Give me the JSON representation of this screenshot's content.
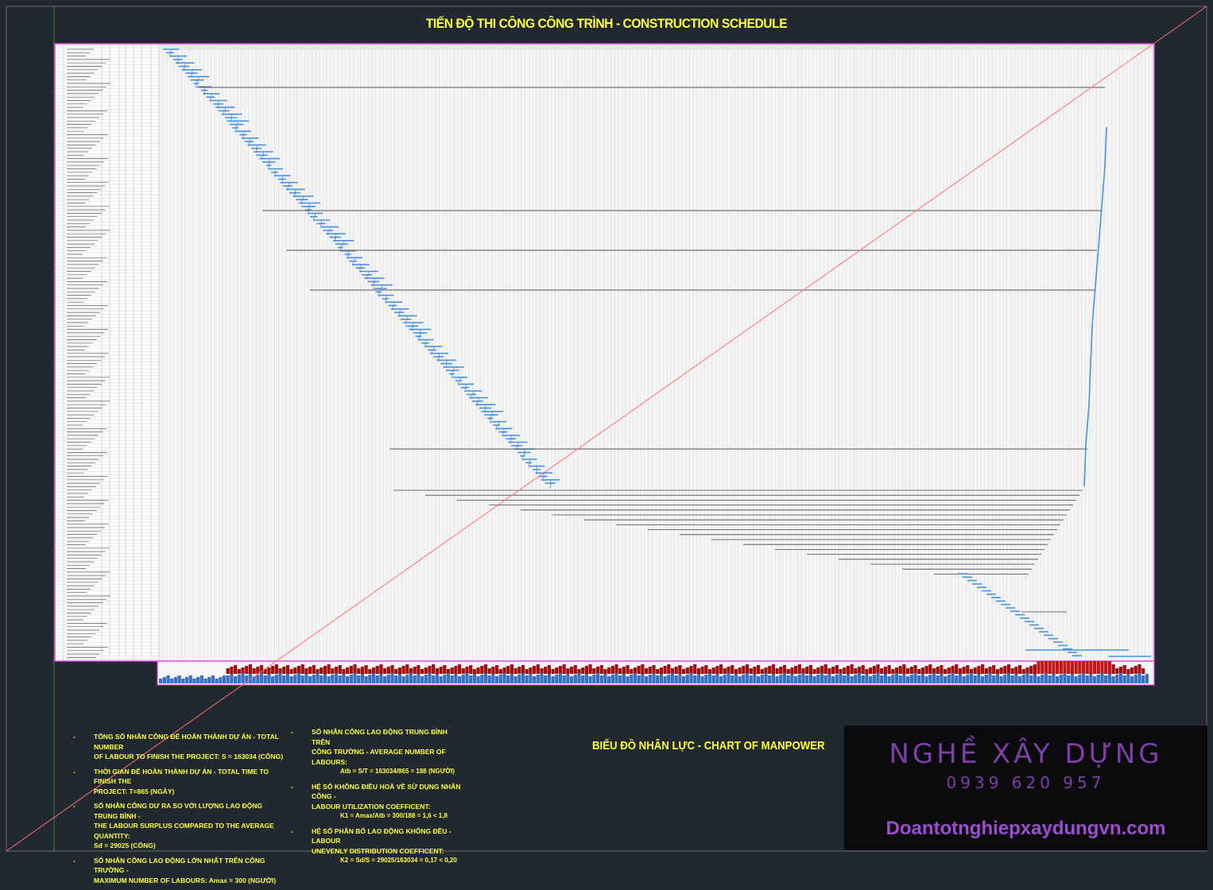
{
  "drawing": {
    "title": "TIẾN ĐỘ THI CÔNG CÔNG TRÌNH - CONSTRUCTION SCHEDULE",
    "manpower_title": "BIỂU ĐỒ NHÂN LỰC - CHART OF MANPOWER"
  },
  "notes_left": [
    {
      "line1": "TỔNG SỐ NHÂN CÔNG ĐỂ HOÀN THÀNH DỰ ÁN - TOTAL NUMBER",
      "line2": "OF LABOUR TO FINISH THE PROJECT: S = 163034 (CÔNG)"
    },
    {
      "line1": "THỜI GIAN ĐỂ HOÀN THÀNH DỰ ÁN - TOTAL TIME TO FINISH THE",
      "line2": "PROJECT: T=865 (NGÀY)"
    },
    {
      "line1": "SỐ NHÂN CÔNG DƯ RA SO VỚI LƯỢNG LAO ĐỘNG TRUNG BÌNH -",
      "line2": "THE LABOUR SURPLUS COMPARED TO THE AVERAGE QUANTITY:",
      "line3": "Sđ = 29025 (CÔNG)"
    },
    {
      "line1": "SỐ NHÂN CÔNG LAO ĐỘNG LỚN NHẤT TRÊN CÔNG TRƯỜNG -",
      "line2": "MAXIMUM NUMBER OF LABOURS: Amax = 300 (NGƯỜI)"
    }
  ],
  "notes_right": [
    {
      "line1": "SỐ NHÂN CÔNG LAO ĐỘNG TRUNG BÌNH TRÊN",
      "line2": "CÔNG TRƯỜNG - AVERAGE NUMBER OF LABOURS:",
      "formula": "Atb = S/T = 163034/865 = 188 (NGƯỜI)"
    },
    {
      "line1": "HỆ SỐ KHÔNG ĐIỀU HOÀ VỀ SỬ DỤNG NHÂN CÔNG -",
      "line2": "LABOUR UTILIZATION COEFFICENT:",
      "formula": "K1 = Amax/Atb = 300/188 = 1,6 < 1,8"
    },
    {
      "line1": "HỆ SỐ PHÂN BỐ LAO ĐỘNG KHÔNG ĐỀU - LABOUR",
      "line2": "UNEVENLY DISTRIBUTION COEFFICENT:",
      "formula": "K2 = Sd/S = 29025/163034 = 0,17 < 0,20"
    }
  ],
  "brand": {
    "name": "NGHỀ XÂY DỰNG",
    "phone": "0939 620 957",
    "site": "Doantotnghiepxaydungvn.com"
  },
  "colors": {
    "background": "#212830",
    "frame_magenta": "#e040e0",
    "title_yellow": "#ffff3c",
    "gantt_blue": "#4a90e0",
    "diagonal_red": "#ff7070",
    "manpower_red": "#a01010",
    "manpower_blue": "#3a70c0",
    "brand_purple": "#7c3fa8"
  }
}
